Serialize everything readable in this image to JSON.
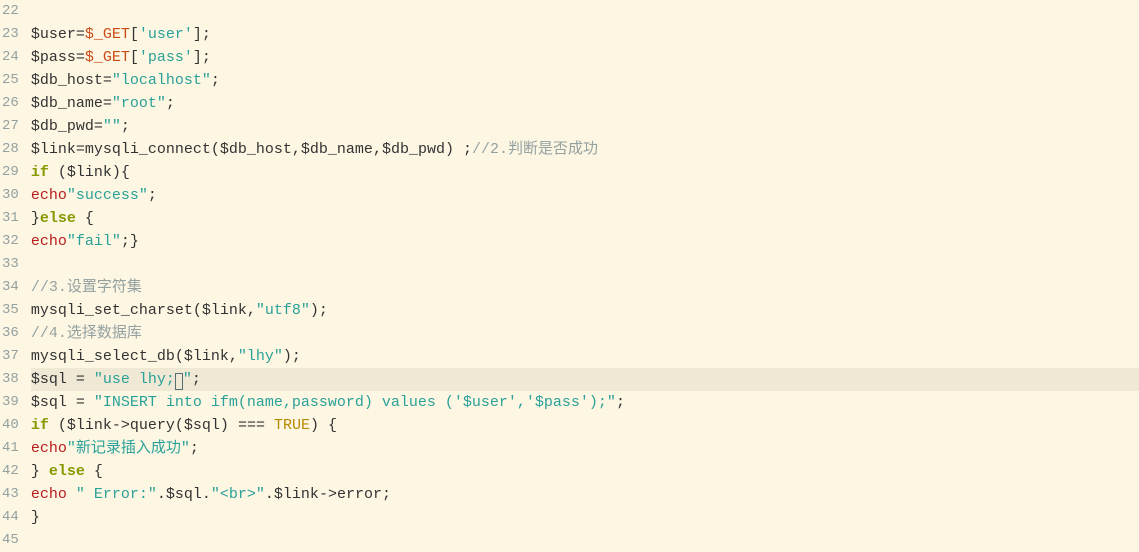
{
  "colors": {
    "background": "#fdf6e3",
    "currentLine": "#eee8d5",
    "gutter": "#93a1a1",
    "keyword": "#859900",
    "string": "#2aa198",
    "echo": "#b71c1c",
    "bool": "#b58900",
    "comment": "#93a1a1"
  },
  "currentLineNumber": 38,
  "lines": [
    {
      "num": 22,
      "tokens": []
    },
    {
      "num": 23,
      "tokens": [
        {
          "t": "$user",
          "c": "c-var"
        },
        {
          "t": "=",
          "c": "c-op"
        },
        {
          "t": "$_GET",
          "c": "c-const"
        },
        {
          "t": "[",
          "c": "c-punct"
        },
        {
          "t": "'user'",
          "c": "c-str"
        },
        {
          "t": "]",
          "c": "c-punct"
        },
        {
          "t": ";",
          "c": "c-punct"
        }
      ]
    },
    {
      "num": 24,
      "tokens": [
        {
          "t": "$pass",
          "c": "c-var"
        },
        {
          "t": "=",
          "c": "c-op"
        },
        {
          "t": "$_GET",
          "c": "c-const"
        },
        {
          "t": "[",
          "c": "c-punct"
        },
        {
          "t": "'pass'",
          "c": "c-str"
        },
        {
          "t": "]",
          "c": "c-punct"
        },
        {
          "t": ";",
          "c": "c-punct"
        }
      ]
    },
    {
      "num": 25,
      "tokens": [
        {
          "t": "$db_host",
          "c": "c-var"
        },
        {
          "t": "=",
          "c": "c-op"
        },
        {
          "t": "\"localhost\"",
          "c": "c-str"
        },
        {
          "t": ";",
          "c": "c-punct"
        }
      ]
    },
    {
      "num": 26,
      "tokens": [
        {
          "t": "$db_name",
          "c": "c-var"
        },
        {
          "t": "=",
          "c": "c-op"
        },
        {
          "t": "\"root\"",
          "c": "c-str"
        },
        {
          "t": ";",
          "c": "c-punct"
        }
      ]
    },
    {
      "num": 27,
      "tokens": [
        {
          "t": "$db_pwd",
          "c": "c-var"
        },
        {
          "t": "=",
          "c": "c-op"
        },
        {
          "t": "\"\"",
          "c": "c-str"
        },
        {
          "t": ";",
          "c": "c-punct"
        }
      ]
    },
    {
      "num": 28,
      "tokens": [
        {
          "t": "$link",
          "c": "c-var"
        },
        {
          "t": "=",
          "c": "c-op"
        },
        {
          "t": "mysqli_connect",
          "c": "c-func"
        },
        {
          "t": "(",
          "c": "c-punct"
        },
        {
          "t": "$db_host",
          "c": "c-var"
        },
        {
          "t": ",",
          "c": "c-punct"
        },
        {
          "t": "$db_name",
          "c": "c-var"
        },
        {
          "t": ",",
          "c": "c-punct"
        },
        {
          "t": "$db_pwd",
          "c": "c-var"
        },
        {
          "t": ") ",
          "c": "c-punct"
        },
        {
          "t": ";",
          "c": "c-punct"
        },
        {
          "t": "//2.判断是否成功",
          "c": "c-comment"
        }
      ]
    },
    {
      "num": 29,
      "tokens": [
        {
          "t": "if ",
          "c": "c-kw"
        },
        {
          "t": "(",
          "c": "c-punct"
        },
        {
          "t": "$link",
          "c": "c-var"
        },
        {
          "t": ")",
          "c": "c-punct"
        },
        {
          "t": "{",
          "c": "c-brace"
        }
      ]
    },
    {
      "num": 30,
      "tokens": [
        {
          "t": "echo",
          "c": "c-echo"
        },
        {
          "t": "\"success\"",
          "c": "c-str"
        },
        {
          "t": ";",
          "c": "c-punct"
        }
      ]
    },
    {
      "num": 31,
      "tokens": [
        {
          "t": "}",
          "c": "c-brace"
        },
        {
          "t": "else ",
          "c": "c-kw"
        },
        {
          "t": "{",
          "c": "c-brace"
        }
      ]
    },
    {
      "num": 32,
      "tokens": [
        {
          "t": "echo",
          "c": "c-echo"
        },
        {
          "t": "\"fail\"",
          "c": "c-str"
        },
        {
          "t": ";",
          "c": "c-punct"
        },
        {
          "t": "}",
          "c": "c-brace"
        }
      ]
    },
    {
      "num": 33,
      "tokens": []
    },
    {
      "num": 34,
      "tokens": [
        {
          "t": "//3.设置字符集",
          "c": "c-comment"
        }
      ]
    },
    {
      "num": 35,
      "tokens": [
        {
          "t": "mysqli_set_charset",
          "c": "c-func"
        },
        {
          "t": "(",
          "c": "c-punct"
        },
        {
          "t": "$link",
          "c": "c-var"
        },
        {
          "t": ",",
          "c": "c-punct"
        },
        {
          "t": "\"utf8\"",
          "c": "c-str"
        },
        {
          "t": ")",
          "c": "c-punct"
        },
        {
          "t": ";",
          "c": "c-punct"
        }
      ]
    },
    {
      "num": 36,
      "tokens": [
        {
          "t": "//4.选择数据库",
          "c": "c-comment"
        }
      ]
    },
    {
      "num": 37,
      "tokens": [
        {
          "t": "mysqli_select_db",
          "c": "c-func"
        },
        {
          "t": "(",
          "c": "c-punct"
        },
        {
          "t": "$link",
          "c": "c-var"
        },
        {
          "t": ",",
          "c": "c-punct"
        },
        {
          "t": "\"lhy\"",
          "c": "c-str"
        },
        {
          "t": ")",
          "c": "c-punct"
        },
        {
          "t": ";",
          "c": "c-punct"
        }
      ]
    },
    {
      "num": 38,
      "current": true,
      "tokens": [
        {
          "t": "$sql ",
          "c": "c-var"
        },
        {
          "t": "= ",
          "c": "c-op"
        },
        {
          "t": "\"use lhy;",
          "c": "c-str"
        },
        {
          "cursor": true
        },
        {
          "t": "\"",
          "c": "c-str"
        },
        {
          "t": ";",
          "c": "c-punct"
        }
      ]
    },
    {
      "num": 39,
      "tokens": [
        {
          "t": "$sql ",
          "c": "c-var"
        },
        {
          "t": "= ",
          "c": "c-op"
        },
        {
          "t": "\"INSERT into ifm(name,password) values ('$user','$pass');\"",
          "c": "c-str"
        },
        {
          "t": ";",
          "c": "c-punct"
        }
      ]
    },
    {
      "num": 40,
      "tokens": [
        {
          "t": "if ",
          "c": "c-kw"
        },
        {
          "t": "(",
          "c": "c-punct"
        },
        {
          "t": "$link",
          "c": "c-var"
        },
        {
          "t": "->",
          "c": "c-op"
        },
        {
          "t": "query",
          "c": "c-func"
        },
        {
          "t": "(",
          "c": "c-punct"
        },
        {
          "t": "$sql",
          "c": "c-var"
        },
        {
          "t": ") ",
          "c": "c-punct"
        },
        {
          "t": "=== ",
          "c": "c-op"
        },
        {
          "t": "TRUE",
          "c": "c-bool"
        },
        {
          "t": ") ",
          "c": "c-punct"
        },
        {
          "t": "{",
          "c": "c-brace"
        }
      ]
    },
    {
      "num": 41,
      "tokens": [
        {
          "t": "echo",
          "c": "c-echo"
        },
        {
          "t": "\"新记录插入成功\"",
          "c": "c-str"
        },
        {
          "t": ";",
          "c": "c-punct"
        }
      ]
    },
    {
      "num": 42,
      "tokens": [
        {
          "t": "} ",
          "c": "c-brace"
        },
        {
          "t": "else ",
          "c": "c-kw"
        },
        {
          "t": "{",
          "c": "c-brace"
        }
      ]
    },
    {
      "num": 43,
      "tokens": [
        {
          "t": "echo ",
          "c": "c-echo"
        },
        {
          "t": "\" Error:\"",
          "c": "c-str"
        },
        {
          "t": ".",
          "c": "c-op"
        },
        {
          "t": "$sql",
          "c": "c-var"
        },
        {
          "t": ".",
          "c": "c-op"
        },
        {
          "t": "\"<br>\"",
          "c": "c-str"
        },
        {
          "t": ".",
          "c": "c-op"
        },
        {
          "t": "$link",
          "c": "c-var"
        },
        {
          "t": "->",
          "c": "c-op"
        },
        {
          "t": "error",
          "c": "c-func"
        },
        {
          "t": ";",
          "c": "c-punct"
        }
      ]
    },
    {
      "num": 44,
      "tokens": [
        {
          "t": "}",
          "c": "c-brace"
        }
      ]
    },
    {
      "num": 45,
      "tokens": []
    }
  ]
}
